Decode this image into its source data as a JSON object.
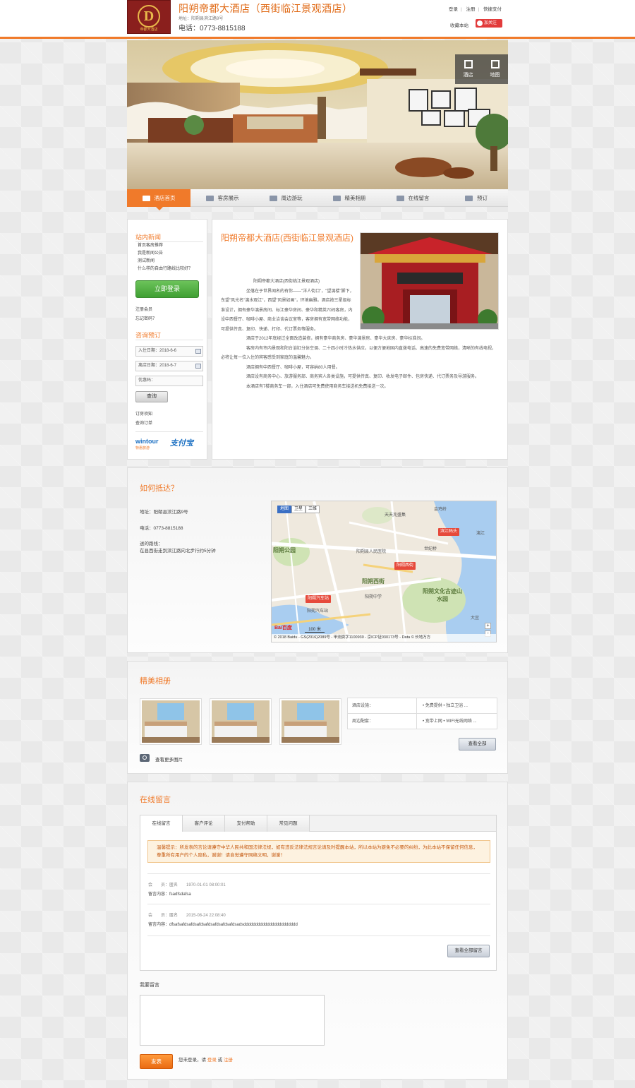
{
  "header": {
    "logo_letter": "D",
    "logo_sub": "帝都大酒店",
    "hotel_name": "阳朔帝都大酒店（西街临江景观酒店）",
    "address": "地址：阳朔县滨江路9号",
    "phone": "电话：0773-8815188",
    "links": [
      "登录",
      "注册",
      "快捷支付"
    ],
    "collect": "收藏本站",
    "follow": "加关注"
  },
  "banner_tools": [
    {
      "label": "酒店",
      "icon": "hotel-icon"
    },
    {
      "label": "地图",
      "icon": "map-icon"
    }
  ],
  "nav": [
    {
      "label": "酒店首页",
      "icon": "cup-icon",
      "active": true
    },
    {
      "label": "客房展示",
      "icon": "bed-icon",
      "active": false
    },
    {
      "label": "周边游玩",
      "icon": "plane-icon",
      "active": false
    },
    {
      "label": "精美相册",
      "icon": "photo-icon",
      "active": false
    },
    {
      "label": "在线留言",
      "icon": "chat-icon",
      "active": false
    },
    {
      "label": "预订",
      "icon": "cart-icon",
      "active": false
    }
  ],
  "sidebar": {
    "news_title": "站内新闻",
    "news": [
      "首页客房推荐",
      "我是新闻公告",
      "测试新闻",
      "什么样的自由行路线比较好？"
    ],
    "login_button": "立即登录",
    "register_link": "注册会员",
    "forgot_link": "忘记密码？",
    "booking_title": "咨询预订",
    "checkin": "入住日期：2018-6-6",
    "checkout": "离店日期：2018-6-7",
    "coupon_placeholder": "优惠码：",
    "query_button": "查询",
    "booking_notice": "订房须知",
    "booking_query": "查询订单",
    "wintour": "wintour",
    "wintour_sub": "特惠旅游",
    "alipay": "支付宝"
  },
  "intro": {
    "title": "阳朔帝都大酒店(西街临江景观酒店)",
    "paragraphs": [
      "阳朔帝都大酒店(西街临江景观酒店)",
      "坐落在于世界闻名的有你——\"洋人街口\"，\"望漓楼\"脚下，东望\"风光名\"漓水观江\"，西望\"风景如画\"，环境幽雅。酒店按三星级标准设计，拥有豪华漓景房间、标江豪华房间、豪华和精英70间客房，内设中西餐厅、咖啡小屋、商业洽谈会议室等，客房拥有宽带网络功能，可提供传真、复印、快递、打印、代订票务等服务。",
      "酒店于2012年底经过全面改造装修，拥有豪华商务房、豪华漓景房、豪华大床房、豪华标准间。",
      "客房内有市内景观和阳台浴缸分体空调、二十四小时冷热水供应，以便方便地国内直拨电话、高速的免费宽带网络，清晰的有线电视，必将让每一位入住的宾客感受到家庭的温馨魅力。",
      "酒店拥有中西餐厅、咖啡小屋，可容纳80人用餐。",
      "酒店设有商务中心、旅游服务部、商务宾人各类设施，可提供传真、复印、收发电子邮件、包房快递、代订票务及导游服务。",
      "本酒店有7楼商务车一部，入住酒店可免费使用商务车接送机免费接送一次。"
    ]
  },
  "directions": {
    "title": "如何抵达？",
    "address": "地址：阳朔县滨江路9号",
    "phone": "电话：0773-8815188",
    "transport_label": "送的路线：",
    "transport": "在县西街走到滨江路向北步行约5分钟",
    "map": {
      "types": [
        "地图",
        "卫星",
        "三维"
      ],
      "labels": [
        "天天兆盛集",
        "阳朔公园",
        "阳朔西街",
        "阳朔文化古迹山水园",
        "阳朔县人民医院",
        "阳朔汽车站",
        "世纪桥",
        "大宜",
        "阳朔中学",
        "漓江",
        "金鸡岭"
      ],
      "pins": [
        "滨江码头",
        "阳朔西街",
        "阳朔汽车站"
      ],
      "scale": "100 米",
      "copyright": "© 2018 Baidu - GS(2016)2089号 - 甲测资字1100930 - 京ICP证030173号 - Data © 长地万方",
      "baidu": "Bai百度"
    }
  },
  "gallery": {
    "title": "精美相册",
    "facilities": [
      {
        "key": "酒店设施：",
        "value": "• 免费提供 • 独立卫浴 ..."
      },
      {
        "key": "周边配套：",
        "value": "• 宽带上网 • WIFI无线网络 ..."
      }
    ],
    "view_all": "查看全部",
    "more_photos": "查看更多图片"
  },
  "messages": {
    "title": "在线留言",
    "tabs": [
      "在线留言",
      "客户评论",
      "支付帮助",
      "常见问题"
    ],
    "notice": "温馨提示：所发表的言论请遵守中华人民共和国法律法规，如有违反法律法规言论请及时提醒本站，所以本站为避免不必要的纠纷，为此本站不保留任何信息，尊重所有用户的个人隐私，谢谢！请自觉遵守网络文明，谢谢！",
    "items": [
      {
        "meta": "会　　员：匿名　　1970-01-01 08:00:01",
        "content": "留言内容：fsadfsdafsa"
      },
      {
        "meta": "会　　员：匿名　　2015-08-24 22:08:40",
        "content": "留言内容：dfsafsafdsafdsafdsafdsafdsafdsafdsadsddddddddddddddddddddddd"
      }
    ],
    "view_all": "查看全部留言",
    "leave_label": "我要留言",
    "submit": "发表",
    "login_tip_prefix": "您未登录，请",
    "login_link": "登录",
    "or": "或",
    "register_link": "注册"
  }
}
